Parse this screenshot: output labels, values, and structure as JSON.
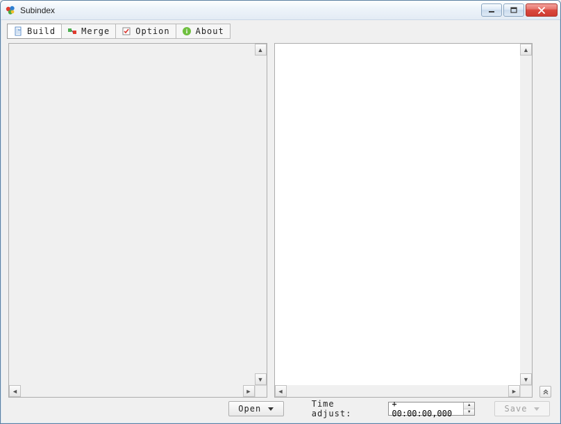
{
  "window": {
    "title": "Subindex"
  },
  "toolbar": {
    "tabs": [
      {
        "label": "Build",
        "icon": "document-new-icon"
      },
      {
        "label": "Merge",
        "icon": "merge-icon"
      },
      {
        "label": "Option",
        "icon": "checkbox-icon"
      },
      {
        "label": "About",
        "icon": "info-icon"
      }
    ]
  },
  "bottom": {
    "open_label": "Open",
    "time_adjust_label": "Time adjust:",
    "time_value": "+ 00:00:00,000",
    "save_label": "Save"
  }
}
